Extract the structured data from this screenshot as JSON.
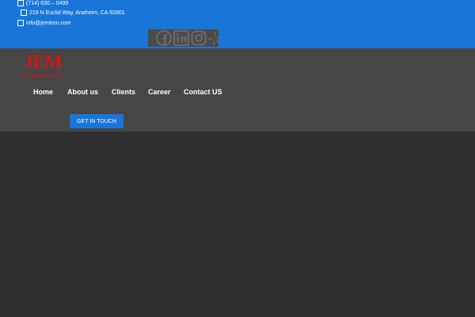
{
  "topbar": {
    "phone": "(714) 630 – 0499",
    "address": "219 N Euclid Way, Anaheim, CA 92801",
    "email": "info@jemiron.com",
    "social_icons": [
      "facebook-icon",
      "linkedin-icon",
      "instagram-icon",
      "yelp-icon"
    ]
  },
  "header": {
    "logo_text": "JEM",
    "logo_subtext": "Industrial Iron, Inc.",
    "nav": [
      "Home",
      "About us",
      "Clients",
      "Career",
      "Contact US"
    ],
    "cta_label": "GET IN TOUCH"
  },
  "colors": {
    "topbar_bg": "#1976d8",
    "header_bg": "#464646",
    "page_bg": "#2f2f2f",
    "logo_red": "#d11616",
    "cta_bg": "#1976d8"
  }
}
